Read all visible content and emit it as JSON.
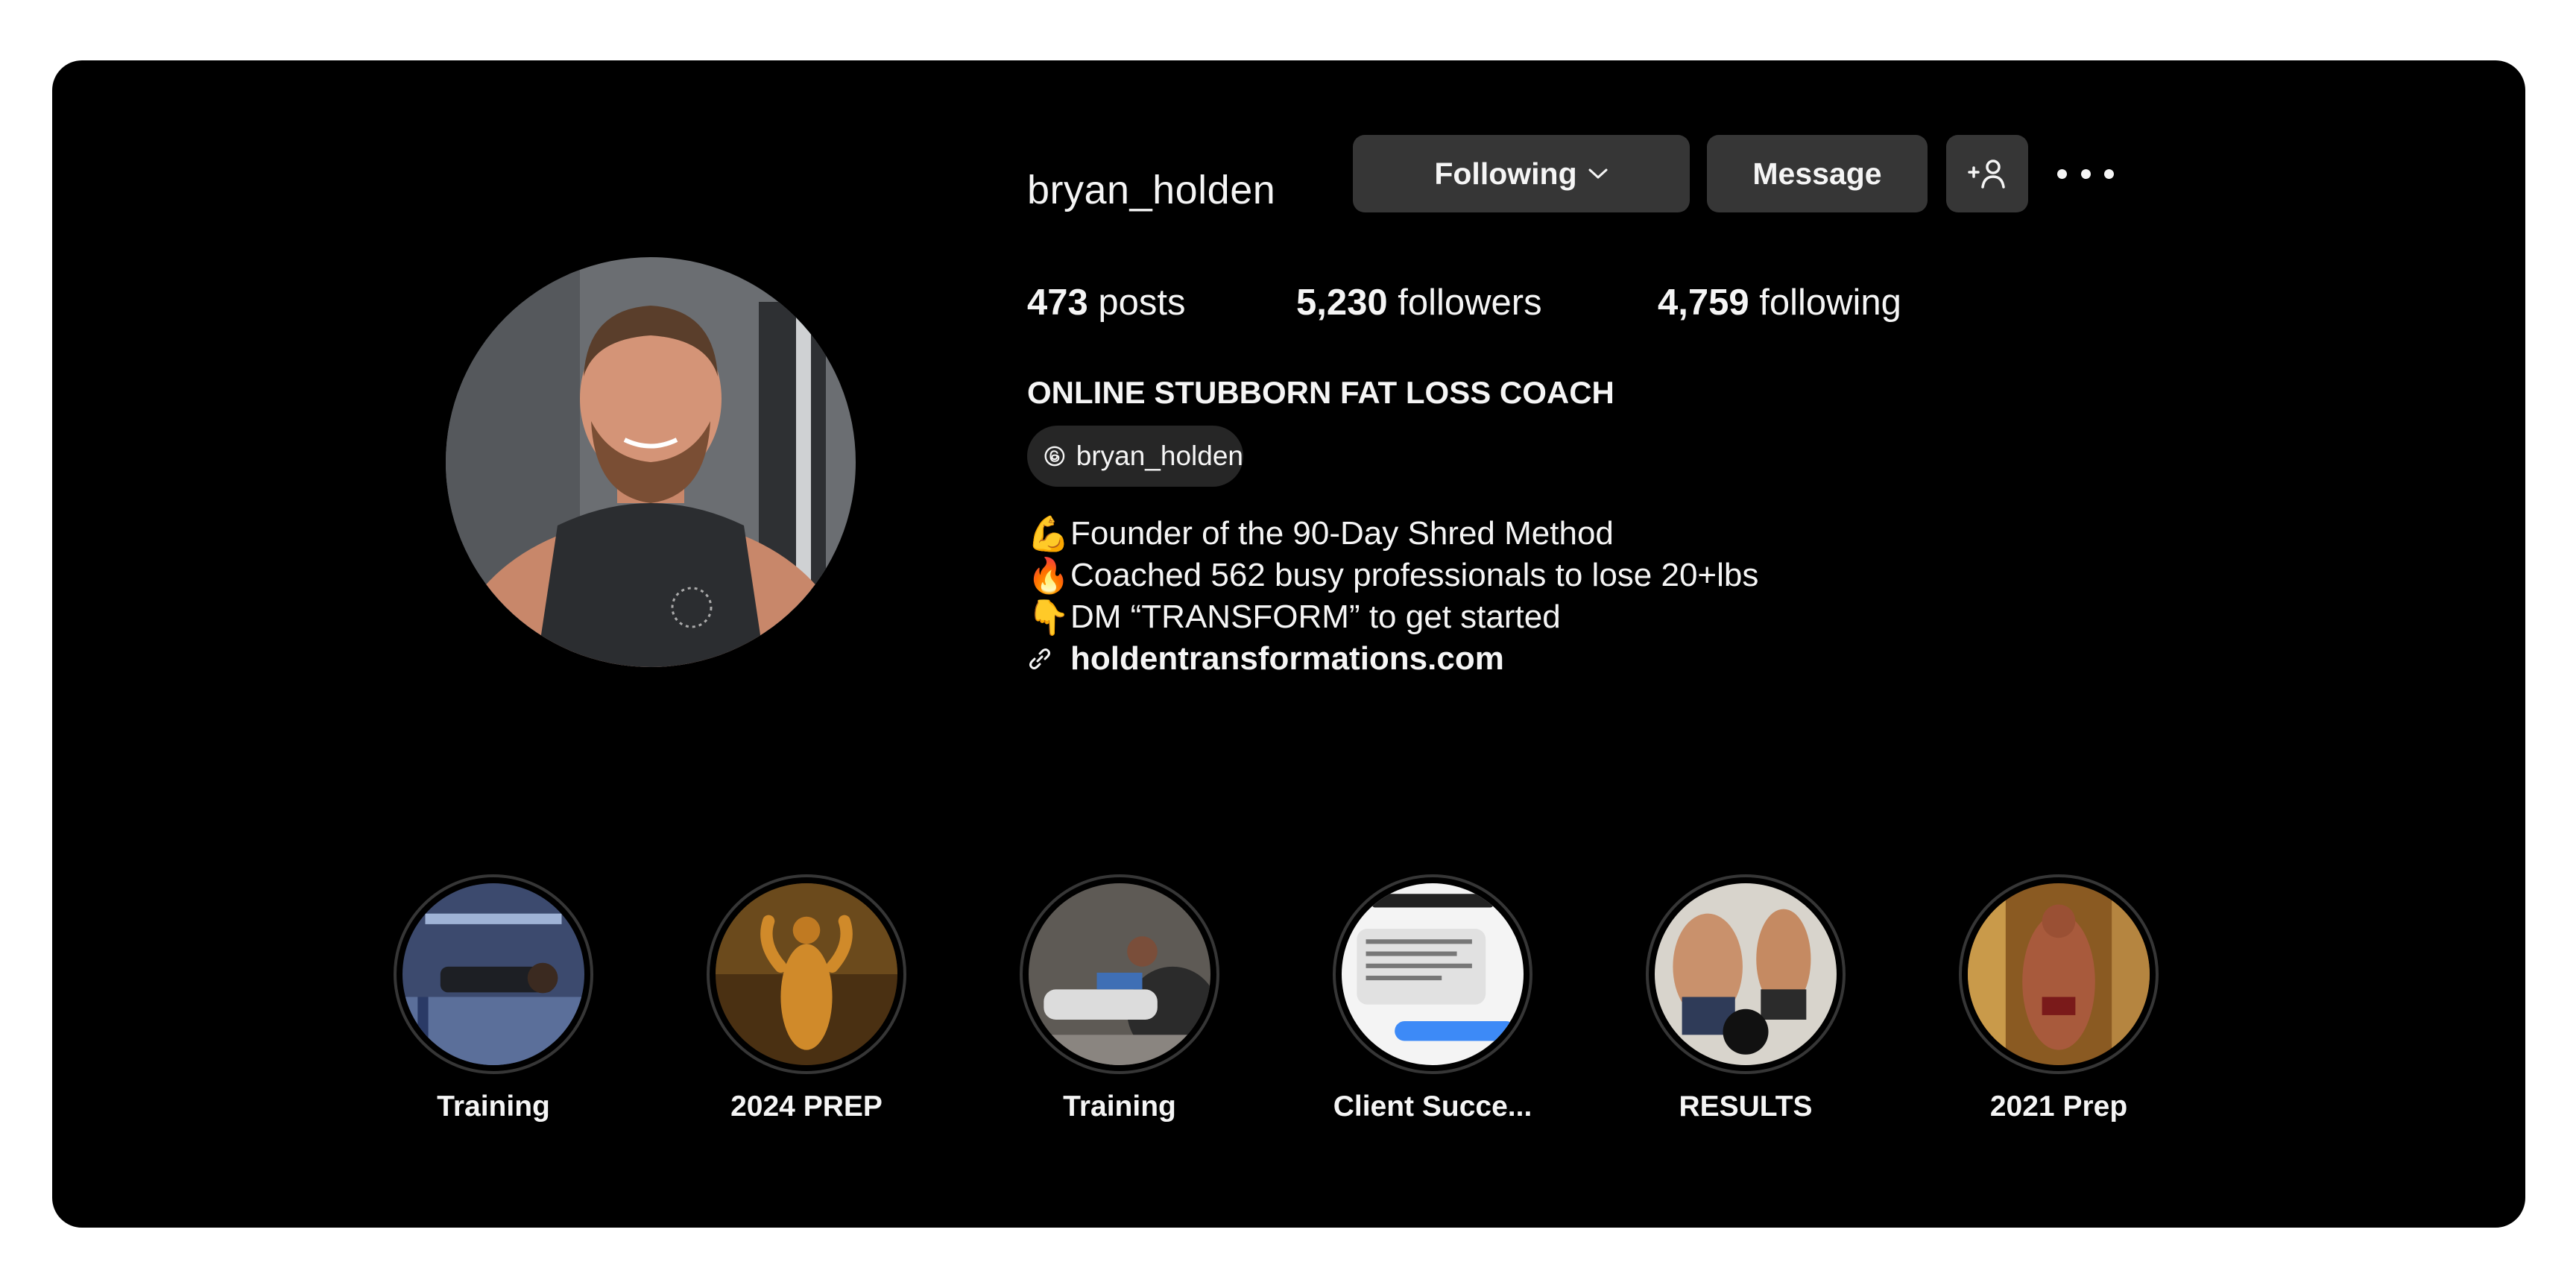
{
  "profile": {
    "username": "bryan_holden",
    "avatar_icon": "profile-photo",
    "buttons": {
      "following_label": "Following",
      "message_label": "Message",
      "add_user_icon": "add-user-icon",
      "more_icon": "more-options-icon"
    },
    "stats": {
      "posts_count": "473",
      "posts_label": "posts",
      "followers_count": "5,230",
      "followers_label": "followers",
      "following_count": "4,759",
      "following_label": "following"
    },
    "bio": {
      "title": "ONLINE STUBBORN FAT LOSS COACH",
      "threads_handle": "bryan_holden",
      "lines": [
        {
          "emoji": "💪",
          "text": "Founder of the 90-Day Shred Method"
        },
        {
          "emoji": "🔥",
          "text": "Coached 562 busy professionals to lose 20+lbs"
        },
        {
          "emoji": "👇",
          "text": "DM “TRANSFORM” to get started"
        }
      ],
      "link": "holdentransformations.com"
    }
  },
  "highlights": [
    {
      "label": "Training"
    },
    {
      "label": "2024 PREP"
    },
    {
      "label": "Training"
    },
    {
      "label": "Client Succe..."
    },
    {
      "label": "RESULTS"
    },
    {
      "label": "2021 Prep"
    }
  ],
  "colors": {
    "background": "#000000",
    "text": "#f5f5f5",
    "button": "#363636",
    "chip": "#262626"
  }
}
